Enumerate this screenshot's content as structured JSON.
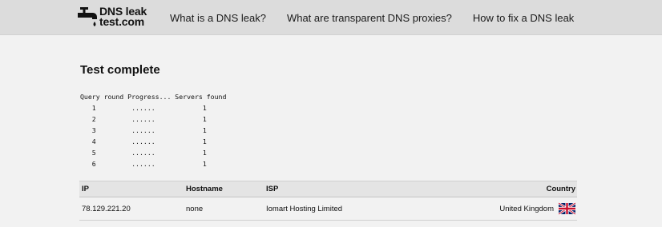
{
  "header": {
    "logo_line1": "DNS leak",
    "logo_line2": "test.com",
    "nav": [
      {
        "label": "What is a DNS leak?"
      },
      {
        "label": "What are transparent DNS proxies?"
      },
      {
        "label": "How to fix a DNS leak"
      }
    ]
  },
  "main": {
    "title": "Test complete",
    "query_header": "Query round Progress... Servers found",
    "query_rows": [
      {
        "round": "1",
        "progress": "......",
        "servers": "1"
      },
      {
        "round": "2",
        "progress": "......",
        "servers": "1"
      },
      {
        "round": "3",
        "progress": "......",
        "servers": "1"
      },
      {
        "round": "4",
        "progress": "......",
        "servers": "1"
      },
      {
        "round": "5",
        "progress": "......",
        "servers": "1"
      },
      {
        "round": "6",
        "progress": "......",
        "servers": "1"
      }
    ]
  },
  "table": {
    "headers": {
      "ip": "IP",
      "hostname": "Hostname",
      "isp": "ISP",
      "country": "Country"
    },
    "rows": [
      {
        "ip": "78.129.221.20",
        "hostname": "none",
        "isp": "Iomart Hosting Limited",
        "country": "United Kingdom",
        "flag_icon": "uk-flag-icon"
      }
    ]
  }
}
